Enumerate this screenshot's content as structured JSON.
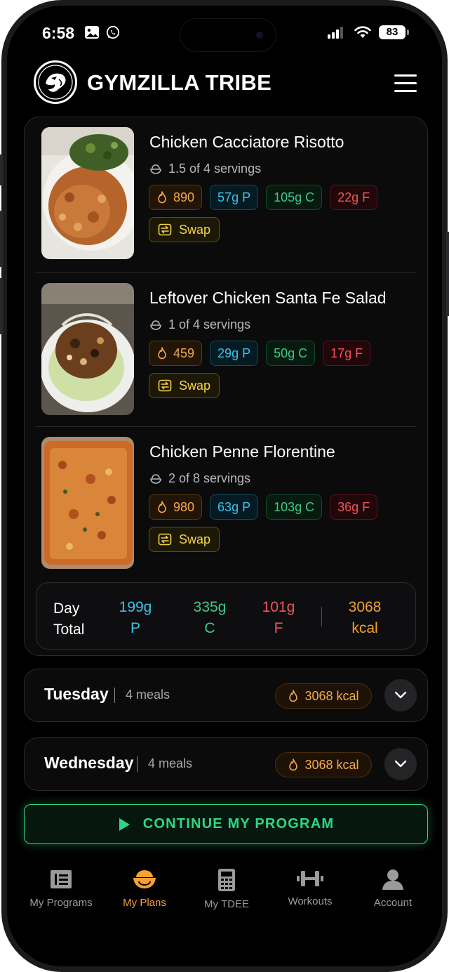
{
  "status_bar": {
    "time": "6:58",
    "battery": "83"
  },
  "header": {
    "brand": "GYMZILLA TRIBE"
  },
  "meals": [
    {
      "title": "Chicken Cacciatore Risotto",
      "servings": "1.5 of 4 servings",
      "kcal": "890",
      "protein": "57g P",
      "carbs": "105g C",
      "fat": "22g F",
      "swap_label": "Swap"
    },
    {
      "title": "Leftover Chicken Santa Fe Salad",
      "servings": "1 of 4 servings",
      "kcal": "459",
      "protein": "29g P",
      "carbs": "50g C",
      "fat": "17g F",
      "swap_label": "Swap"
    },
    {
      "title": "Chicken Penne Florentine",
      "servings": "2 of 8 servings",
      "kcal": "980",
      "protein": "63g P",
      "carbs": "103g C",
      "fat": "36g F",
      "swap_label": "Swap"
    }
  ],
  "day_total": {
    "label_line1": "Day",
    "label_line2": "Total",
    "protein_value": "199g",
    "protein_unit": "P",
    "carbs_value": "335g",
    "carbs_unit": "C",
    "fat_value": "101g",
    "fat_unit": "F",
    "kcal_value": "3068",
    "kcal_unit": "kcal"
  },
  "days": [
    {
      "name": "Tuesday",
      "meals": "4 meals",
      "kcal": "3068 kcal"
    },
    {
      "name": "Wednesday",
      "meals": "4 meals",
      "kcal": "3068 kcal"
    }
  ],
  "cta": {
    "label": "CONTINUE MY PROGRAM"
  },
  "nav": [
    {
      "label": "My Programs",
      "icon": "programs-icon",
      "active": false
    },
    {
      "label": "My Plans",
      "icon": "bowl-icon",
      "active": true
    },
    {
      "label": "My TDEE",
      "icon": "calculator-icon",
      "active": false
    },
    {
      "label": "Workouts",
      "icon": "dumbbell-icon",
      "active": false
    },
    {
      "label": "Account",
      "icon": "user-icon",
      "active": false
    }
  ],
  "colors": {
    "kcal": "#f5a94a",
    "protein": "#3bc3e8",
    "carbs": "#3ecb86",
    "fat": "#f0545c",
    "swap": "#f6d548",
    "cta": "#2fd681",
    "nav_active": "#f5a030"
  }
}
